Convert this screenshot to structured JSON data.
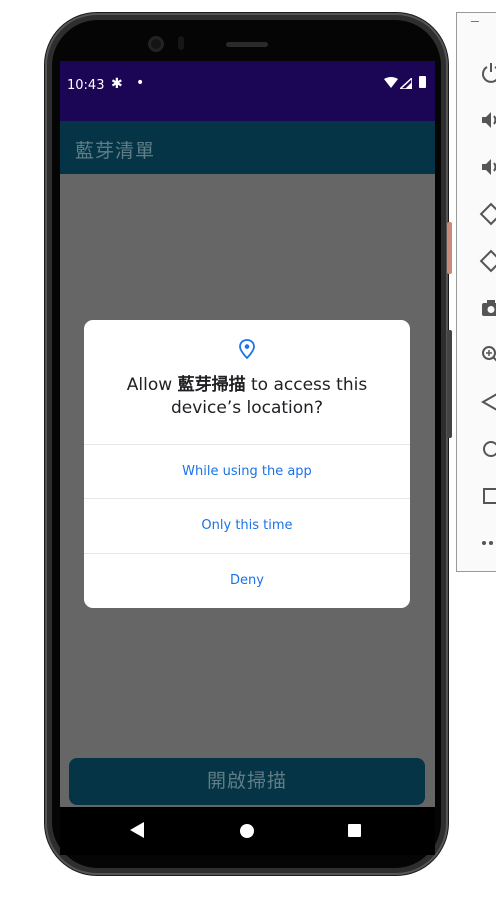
{
  "status_bar": {
    "time": "10:43",
    "settings_icon": "gear-icon",
    "dot": "•",
    "bg_color": "#1b0655"
  },
  "app_bar": {
    "title": "藍芽清單",
    "bg_color": "#043445"
  },
  "dialog": {
    "icon": "location-pin-icon",
    "message_prefix": "Allow ",
    "app_name": "藍芽掃描",
    "message_suffix": " to access this device’s location?",
    "options": [
      {
        "label": "While using the app"
      },
      {
        "label": "Only this time"
      },
      {
        "label": "Deny"
      }
    ],
    "accent_color": "#1a73e8"
  },
  "scan_button": {
    "label": "開啟掃描"
  },
  "nav_bar": {
    "back": "back-icon",
    "home": "home-icon",
    "recents": "recents-icon"
  },
  "emulator_toolbar": {
    "minimize": "–",
    "items": [
      "power-icon",
      "volume-up-icon",
      "volume-down-icon",
      "rotate-left-icon",
      "rotate-right-icon",
      "camera-icon",
      "zoom-icon",
      "back-icon",
      "home-icon",
      "overview-icon",
      "more-icon"
    ]
  }
}
